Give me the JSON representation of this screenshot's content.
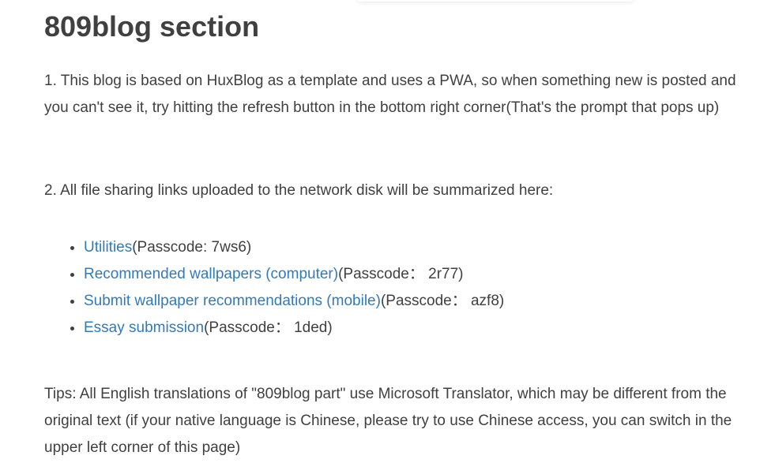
{
  "page": {
    "title": "809blog section"
  },
  "paragraphs": {
    "p1": "1. This blog is based on HuxBlog as a template and uses a PWA, so when something new is posted and you can't see it, try hitting the refresh button in the bottom right corner(That's the prompt that pops up)",
    "p2": "2. All file sharing links uploaded to the network disk will be summarized here:",
    "tips": "Tips: All English translations of \"809blog part\" use Microsoft Translator, which may be different from the original text (if your native language is Chinese, please try to use Chinese access, you can switch in the upper left corner of this page)"
  },
  "links": [
    {
      "label": "Utilities",
      "passcode": "(Passcode: 7ws6)"
    },
    {
      "label": "Recommended wallpapers (computer)",
      "passcode": "(Passcode： 2r77)"
    },
    {
      "label": "Submit wallpaper recommendations (mobile)",
      "passcode": "(Passcode： azf8)"
    },
    {
      "label": "Essay submission",
      "passcode": "(Passcode： 1ded)"
    }
  ],
  "colors": {
    "text": "#404040",
    "link": "#337ab7",
    "background": "#ffffff"
  }
}
